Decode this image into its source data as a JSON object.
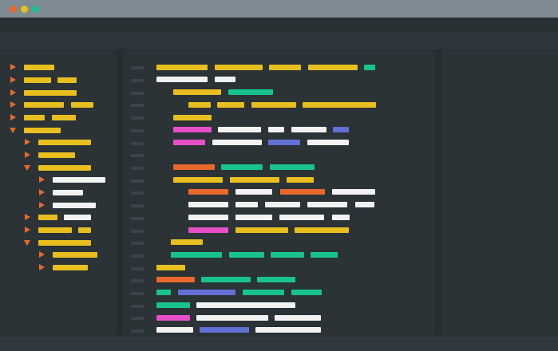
{
  "palette": {
    "yellow": "#e8bf1f",
    "white": "#f2f2f2",
    "green": "#19c48c",
    "magenta": "#e64fc8",
    "blue": "#6270d6",
    "orange": "#e9692c",
    "chrome": "#7f8b92",
    "editor_bg": "#2b3337"
  },
  "window_controls": [
    {
      "name": "close-button",
      "color": "#e9692c"
    },
    {
      "name": "minimize-button",
      "color": "#e8bf1f"
    },
    {
      "name": "maximize-button",
      "color": "#19c48c"
    }
  ],
  "sidebar": {
    "tree_rows": [
      {
        "expander": "right",
        "bars": [
          "yellow"
        ]
      },
      {
        "expander": "right",
        "bars": [
          "yellow",
          "yellow"
        ]
      },
      {
        "expander": "right",
        "bars": [
          "yellow"
        ]
      },
      {
        "expander": "right",
        "bars": [
          "yellow",
          "yellow"
        ]
      },
      {
        "expander": "right",
        "bars": [
          "yellow",
          "yellow"
        ]
      },
      {
        "expander": "down",
        "bars": [
          "yellow"
        ]
      },
      {
        "expander": "right",
        "bars": [
          "yellow"
        ]
      },
      {
        "expander": "right",
        "bars": [
          "yellow"
        ]
      },
      {
        "expander": "down",
        "bars": [
          "yellow"
        ]
      },
      {
        "expander": "right",
        "bars": [
          "white"
        ]
      },
      {
        "expander": "right",
        "bars": [
          "white"
        ]
      },
      {
        "expander": "right",
        "bars": [
          "white"
        ]
      },
      {
        "expander": "right",
        "bars": [
          "yellow",
          "white"
        ]
      },
      {
        "expander": "right",
        "bars": [
          "yellow",
          "yellow"
        ]
      },
      {
        "expander": "down",
        "bars": [
          "yellow"
        ]
      },
      {
        "expander": "right",
        "bars": [
          "yellow"
        ]
      },
      {
        "expander": "right",
        "bars": [
          "yellow"
        ]
      }
    ]
  },
  "editor": {
    "code_lines": [
      [
        "yellow",
        "yellow",
        "yellow",
        "yellow",
        "green"
      ],
      [
        "white",
        "white"
      ],
      [
        "yellow",
        "green"
      ],
      [
        "yellow",
        "yellow",
        "yellow",
        "yellow"
      ],
      [
        "yellow"
      ],
      [
        "magenta",
        "white",
        "white",
        "white",
        "blue"
      ],
      [
        "magenta",
        "white",
        "blue",
        "white"
      ],
      [],
      [
        "orange",
        "green",
        "green"
      ],
      [
        "yellow",
        "yellow",
        "yellow"
      ],
      [
        "orange",
        "white",
        "orange",
        "white"
      ],
      [
        "white",
        "white",
        "white",
        "white",
        "white"
      ],
      [
        "white",
        "white",
        "white",
        "white"
      ],
      [
        "magenta",
        "yellow",
        "yellow"
      ],
      [
        "yellow"
      ],
      [
        "green",
        "green",
        "green",
        "green"
      ],
      [
        "yellow"
      ],
      [
        "orange",
        "green",
        "green"
      ],
      [
        "green",
        "blue",
        "green",
        "green"
      ],
      [
        "green",
        "white"
      ],
      [
        "magenta",
        "white",
        "white"
      ],
      [
        "white",
        "blue",
        "white"
      ]
    ]
  }
}
